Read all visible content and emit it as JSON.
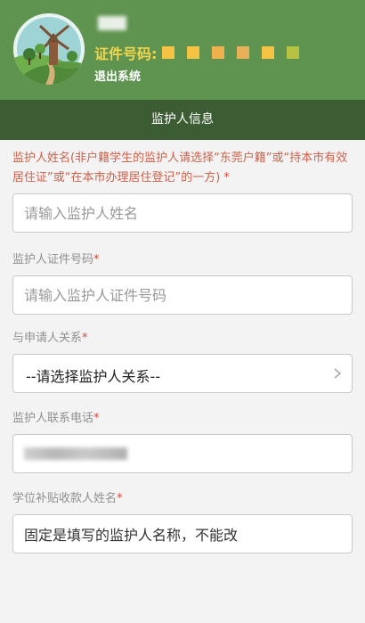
{
  "header": {
    "user_name": "",
    "id_label": "证件号码:",
    "id_blocks": [
      "#f5c243",
      "#f5c243",
      "#f0b14d",
      "#e9b05a",
      "#f5c243",
      "#b7c243"
    ],
    "logout_label": "退出系统"
  },
  "tab": {
    "title": "监护人信息"
  },
  "form": {
    "guardian_name": {
      "label": "监护人姓名(非户籍学生的监护人请选择“东莞户籍”或“持本市有效居住证”或“在本市办理居住登记”的一方)",
      "required": "*",
      "placeholder": "请输入监护人姓名"
    },
    "guardian_id": {
      "label": "监护人证件号码",
      "required": "*",
      "placeholder": "请输入监护人证件号码"
    },
    "relation": {
      "label": "与申请人关系",
      "required": "*",
      "selected": "--请选择监护人关系--"
    },
    "phone": {
      "label": "监护人联系电话",
      "required": "*",
      "value": ""
    },
    "payee_name": {
      "label": "学位补贴收款人姓名",
      "required": "*",
      "value": "固定是填写的监护人名称，不能改"
    }
  }
}
